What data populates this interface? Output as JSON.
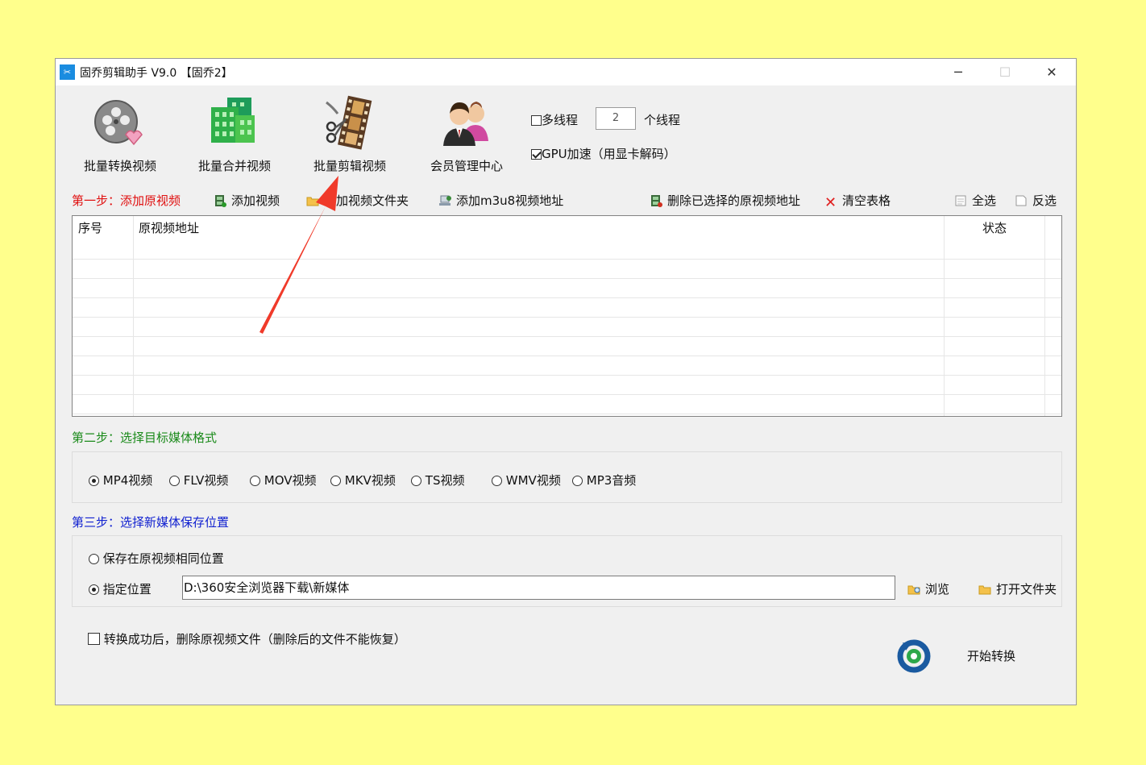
{
  "window": {
    "title": "固乔剪辑助手 V9.0 【固乔2】",
    "app_icon": "scissors-icon",
    "controls": {
      "minimize": "─",
      "maximize": "☐",
      "close": "✕"
    }
  },
  "toolbar": {
    "items": [
      {
        "label": "批量转换视频",
        "icon": "film-reel-heart-icon"
      },
      {
        "label": "批量合并视频",
        "icon": "green-building-blocks-icon"
      },
      {
        "label": "批量剪辑视频",
        "icon": "film-strip-scissors-icon"
      },
      {
        "label": "会员管理中心",
        "icon": "users-icon"
      }
    ],
    "multithread_label": "多线程",
    "multithread_checked": false,
    "thread_count": "2",
    "thread_unit": "个线程",
    "gpu_label": "GPU加速（用显卡解码）",
    "gpu_checked": true
  },
  "step1": {
    "title": "第一步：添加原视频",
    "actions": [
      {
        "label": "添加视频",
        "icon": "film-add-icon"
      },
      {
        "label": "添加视频文件夹",
        "icon": "folder-icon"
      },
      {
        "label": "添加m3u8视频地址",
        "icon": "network-icon"
      },
      {
        "label": "删除已选择的原视频地址",
        "icon": "film-delete-icon"
      },
      {
        "label": "清空表格",
        "icon": "red-x-icon"
      },
      {
        "label": "全选",
        "icon": "document-icon"
      },
      {
        "label": "反选",
        "icon": "page-icon"
      }
    ],
    "table": {
      "columns": [
        "序号",
        "原视频地址",
        "状态"
      ],
      "rows": []
    }
  },
  "step2": {
    "title": "第二步：选择目标媒体格式",
    "formats": [
      "MP4视频",
      "FLV视频",
      "MOV视频",
      "MKV视频",
      "TS视频",
      "WMV视频",
      "MP3音频"
    ],
    "selected": "MP4视频"
  },
  "step3": {
    "title": "第三步：选择新媒体保存位置",
    "option_same": "保存在原视频相同位置",
    "option_custom": "指定位置",
    "selected": "指定位置",
    "path": "D:\\360安全浏览器下载\\新媒体",
    "browse_label": "浏览",
    "open_folder_label": "打开文件夹"
  },
  "footer": {
    "delete_after_label": "转换成功后，删除原视频文件（删除后的文件不能恢复）",
    "delete_after_checked": false,
    "start_label": "开始转换",
    "start_icon": "refresh-cycle-icon"
  },
  "annotation": {
    "arrow_color": "#f03a2a",
    "points_to": "批量剪辑视频"
  }
}
